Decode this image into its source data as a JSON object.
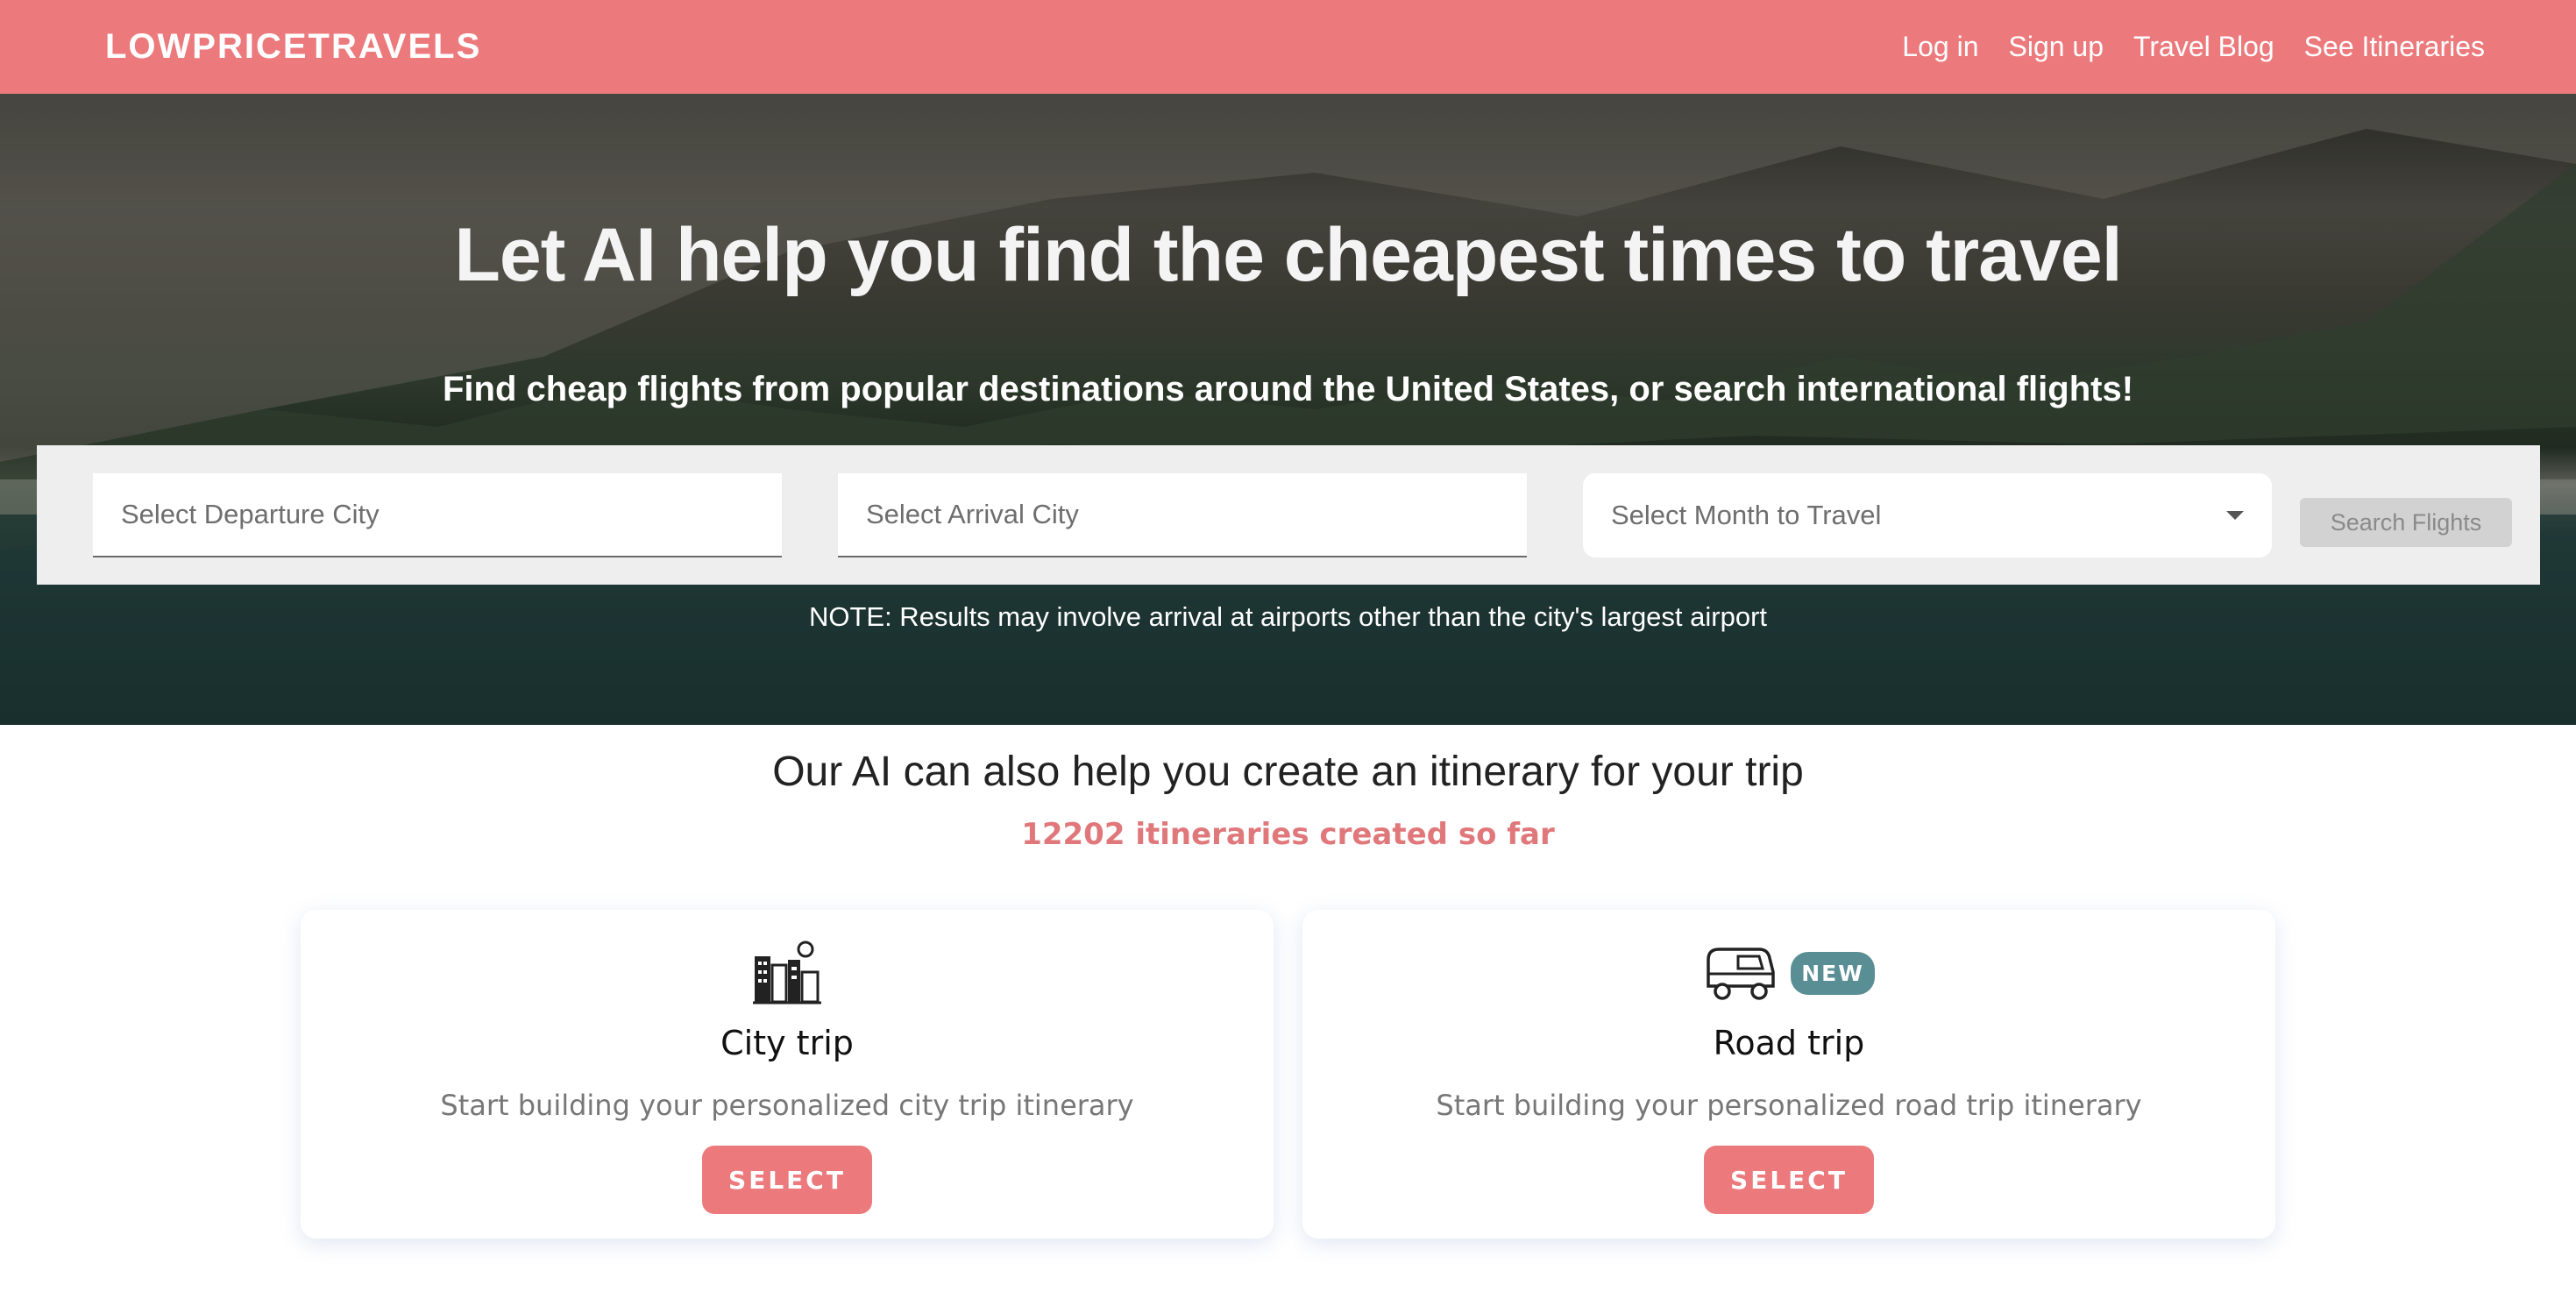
{
  "nav": {
    "brand": "LOWPRICETRAVELS",
    "links": [
      "Log in",
      "Sign up",
      "Travel Blog",
      "See Itineraries"
    ]
  },
  "hero": {
    "title": "Let AI help you find the cheapest times to travel",
    "subtitle": "Find cheap flights from popular destinations around the United States, or search international flights!",
    "note": "NOTE: Results may involve arrival at airports other than the city's largest airport"
  },
  "search": {
    "departure_placeholder": "Select Departure City",
    "arrival_placeholder": "Select Arrival City",
    "month_selected": "Select Month to Travel",
    "button_label": "Search Flights"
  },
  "itinerary": {
    "title": "Our AI can also help you create an itinerary for your trip",
    "count_text": "12202 itineraries created so far",
    "cards": [
      {
        "title": "City trip",
        "description": "Start building your personalized city trip itinerary",
        "button": "SELECT",
        "icon": "city-icon"
      },
      {
        "title": "Road trip",
        "description": "Start building your personalized road trip itinerary",
        "button": "SELECT",
        "icon": "van-icon",
        "badge": "NEW"
      }
    ]
  },
  "colors": {
    "accent": "#ec7a7d",
    "badge": "#5a8e95",
    "count_text": "#e0787b"
  }
}
